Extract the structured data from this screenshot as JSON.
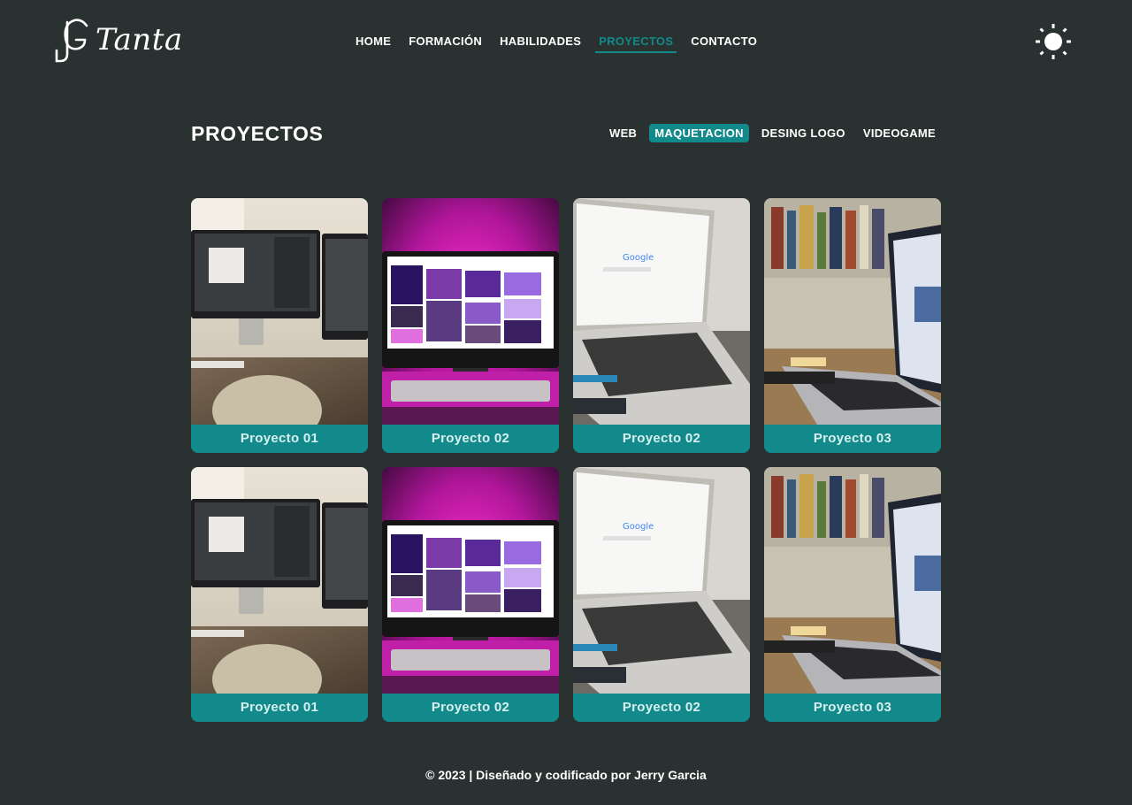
{
  "brand": {
    "logo_text": "Tanta"
  },
  "nav": {
    "items": [
      {
        "label": "HOME",
        "active": false
      },
      {
        "label": "FORMACIÓN",
        "active": false
      },
      {
        "label": "HABILIDADES",
        "active": false
      },
      {
        "label": "PROYECTOS",
        "active": true
      },
      {
        "label": "CONTACTO",
        "active": false
      }
    ]
  },
  "theme_toggle": {
    "icon": "sun-icon"
  },
  "section": {
    "title": "PROYECTOS",
    "filters": [
      {
        "label": "WEB",
        "active": false
      },
      {
        "label": "MAQUETACION",
        "active": true
      },
      {
        "label": "DESING LOGO",
        "active": false
      },
      {
        "label": "VIDEOGAME",
        "active": false
      }
    ]
  },
  "projects": [
    {
      "label": "Proyecto 01",
      "image": "desk-imac-photo"
    },
    {
      "label": "Proyecto 02",
      "image": "pink-imac-photo"
    },
    {
      "label": "Proyecto 02",
      "image": "laptop-google-photo"
    },
    {
      "label": "Proyecto 03",
      "image": "laptop-bookshelf-photo"
    },
    {
      "label": "Proyecto 01",
      "image": "desk-imac-photo"
    },
    {
      "label": "Proyecto 02",
      "image": "pink-imac-photo"
    },
    {
      "label": "Proyecto 02",
      "image": "laptop-google-photo"
    },
    {
      "label": "Proyecto 03",
      "image": "laptop-bookshelf-photo"
    }
  ],
  "footer": {
    "text": "© 2023 | Diseñado y codificado por Jerry Garcia"
  },
  "colors": {
    "background": "#293131",
    "accent": "#12898a",
    "text": "#ffffff"
  }
}
